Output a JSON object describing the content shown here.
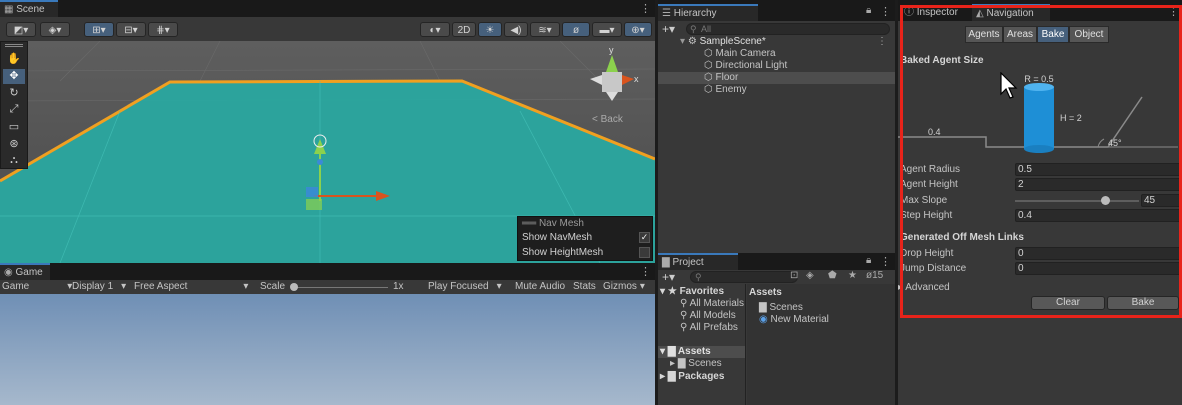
{
  "scene": {
    "tab_label": "Scene",
    "toolbar_2d": "2D",
    "back_label": "< Back",
    "axis_y": "y",
    "axis_x": "x",
    "navmesh_overlay": {
      "title": "Nav Mesh",
      "show_navmesh": "Show NavMesh",
      "show_heightmesh": "Show HeightMesh",
      "show_navmesh_checked": true,
      "show_heightmesh_checked": false
    }
  },
  "game": {
    "tab_label": "Game",
    "mode": "Game",
    "display": "Display 1",
    "aspect": "Free Aspect",
    "scale_label": "Scale",
    "scale_value": "1x",
    "play_focused": "Play Focused",
    "mute_audio": "Mute Audio",
    "stats": "Stats",
    "gizmos": "Gizmos"
  },
  "hierarchy": {
    "tab_label": "Hierarchy",
    "search_placeholder": "All",
    "scene_name": "SampleScene*",
    "items": [
      "Main Camera",
      "Directional Light",
      "Floor",
      "Enemy"
    ],
    "selected": "Floor"
  },
  "project": {
    "tab_label": "Project",
    "hidden_count": "15",
    "favorites_label": "Favorites",
    "favorites": [
      "All Materials",
      "All Models",
      "All Prefabs"
    ],
    "assets_label": "Assets",
    "assets_children": [
      "Scenes"
    ],
    "packages_label": "Packages",
    "breadcrumb": "Assets",
    "content": [
      "Scenes",
      "New Material"
    ]
  },
  "inspector": {
    "tab_inspector": "Inspector",
    "tab_navigation": "Navigation",
    "segments": [
      "Agents",
      "Areas",
      "Bake",
      "Object"
    ],
    "active_segment": "Bake",
    "baked_agent_size": "Baked Agent Size",
    "diagram": {
      "radius_label": "R = 0.5",
      "height_label": "H = 2",
      "step_label": "0.4",
      "slope_label": "45°"
    },
    "fields": {
      "agent_radius_label": "Agent Radius",
      "agent_radius": "0.5",
      "agent_height_label": "Agent Height",
      "agent_height": "2",
      "max_slope_label": "Max Slope",
      "max_slope": "45",
      "max_slope_fraction": 0.75,
      "step_height_label": "Step Height",
      "step_height": "0.4"
    },
    "offmesh_header": "Generated Off Mesh Links",
    "drop_height_label": "Drop Height",
    "drop_height": "0",
    "jump_distance_label": "Jump Distance",
    "jump_distance": "0",
    "advanced_label": "Advanced",
    "clear_button": "Clear",
    "bake_button": "Bake"
  },
  "colors": {
    "highlight_box": "#e8231a",
    "navmesh": "#2aa8a0",
    "floor_outline": "#f0a020",
    "selection_blue": "#46607c",
    "cylinder": "#1e8fd6"
  }
}
